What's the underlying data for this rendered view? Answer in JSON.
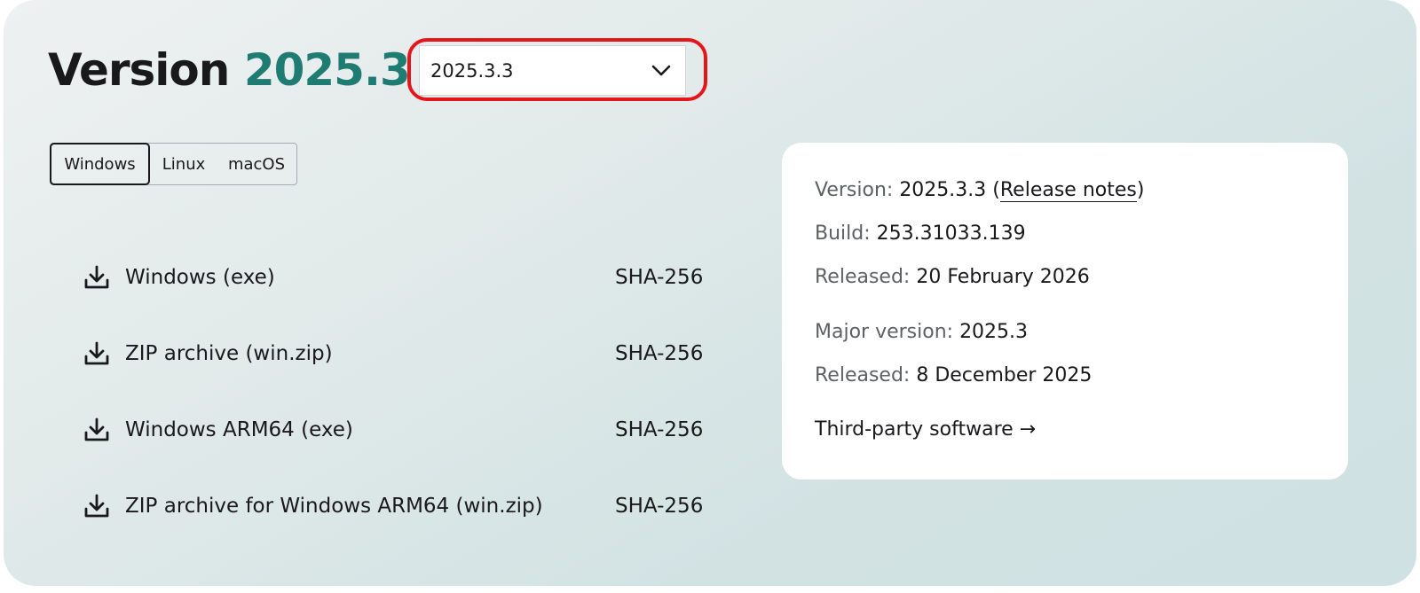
{
  "header": {
    "title_prefix": "Version",
    "title_version": "2025.3"
  },
  "version_select": {
    "selected": "2025.3.3",
    "icon": "chevron-down-icon"
  },
  "os_tabs": [
    {
      "label": "Windows",
      "selected": true
    },
    {
      "label": "Linux",
      "selected": false
    },
    {
      "label": "macOS",
      "selected": false
    }
  ],
  "downloads": [
    {
      "label": "Windows (exe)",
      "checksum": "SHA-256",
      "icon": "download-icon"
    },
    {
      "label": "ZIP archive (win.zip)",
      "checksum": "SHA-256",
      "icon": "download-icon"
    },
    {
      "label": "Windows ARM64 (exe)",
      "checksum": "SHA-256",
      "icon": "download-icon"
    },
    {
      "label": "ZIP archive for Windows ARM64 (win.zip)",
      "checksum": "SHA-256",
      "icon": "download-icon"
    }
  ],
  "info": {
    "version_label": "Version:",
    "version_value": "2025.3.3",
    "release_notes_open": "(",
    "release_notes_label": "Release notes",
    "release_notes_close": ")",
    "build_label": "Build:",
    "build_value": "253.31033.139",
    "released_label": "Released:",
    "released_value": "20 February 2026",
    "major_label": "Major version:",
    "major_value": "2025.3",
    "major_released_label": "Released:",
    "major_released_value": "8 December 2025",
    "third_party_label": "Third-party software",
    "third_party_arrow": "→"
  },
  "colors": {
    "accent": "#1f7c72",
    "highlight": "#e4161c",
    "text": "#19191c",
    "muted_label": "#5d6064"
  }
}
